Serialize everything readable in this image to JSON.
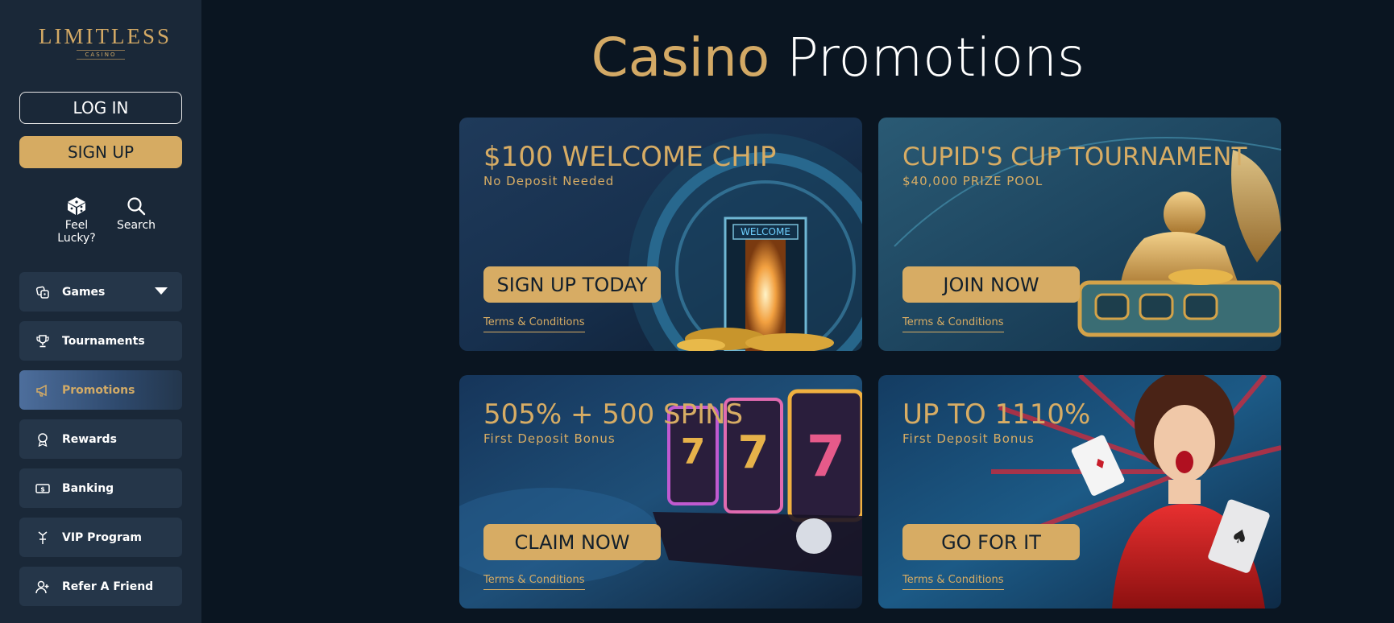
{
  "sidebar": {
    "logo": {
      "main": "LIMITLESS",
      "sub": "CASINO"
    },
    "login_label": "LOG IN",
    "signup_label": "SIGN UP",
    "quick_links": [
      {
        "label": "Feel Lucky?",
        "icon": "dice-icon"
      },
      {
        "label": "Search",
        "icon": "search-icon"
      }
    ],
    "nav": [
      {
        "label": "Games",
        "icon": "dice-pile-icon",
        "has_dropdown": true
      },
      {
        "label": "Tournaments",
        "icon": "trophy-icon"
      },
      {
        "label": "Promotions",
        "icon": "megaphone-icon",
        "active": true
      },
      {
        "label": "Rewards",
        "icon": "medal-icon"
      },
      {
        "label": "Banking",
        "icon": "money-icon"
      },
      {
        "label": "VIP Program",
        "icon": "diamond-figure-icon"
      },
      {
        "label": "Refer A Friend",
        "icon": "user-plus-icon"
      }
    ]
  },
  "main": {
    "title_part1": "Casino",
    "title_part2": "Promotions",
    "promos": [
      {
        "title": "$100 WELCOME CHIP",
        "subtitle": "No Deposit Needed",
        "button": "SIGN UP TODAY",
        "terms": "Terms & Conditions",
        "art_label": "WELCOME"
      },
      {
        "title": "CUPID'S CUP TOURNAMENT",
        "subtitle": "$40,000 PRIZE POOL",
        "button": "JOIN NOW",
        "terms": "Terms & Conditions"
      },
      {
        "title": "505% + 500 SPINS",
        "subtitle": "First Deposit Bonus",
        "button": "CLAIM NOW",
        "terms": "Terms & Conditions"
      },
      {
        "title": "UP TO 1110%",
        "subtitle": "First Deposit Bonus",
        "button": "GO FOR IT",
        "terms": "Terms & Conditions"
      }
    ]
  },
  "colors": {
    "accent_gold": "#d6ab62",
    "sidebar_bg": "#1a2838",
    "nav_item_bg": "#253649",
    "page_bg": "#0a1521"
  }
}
